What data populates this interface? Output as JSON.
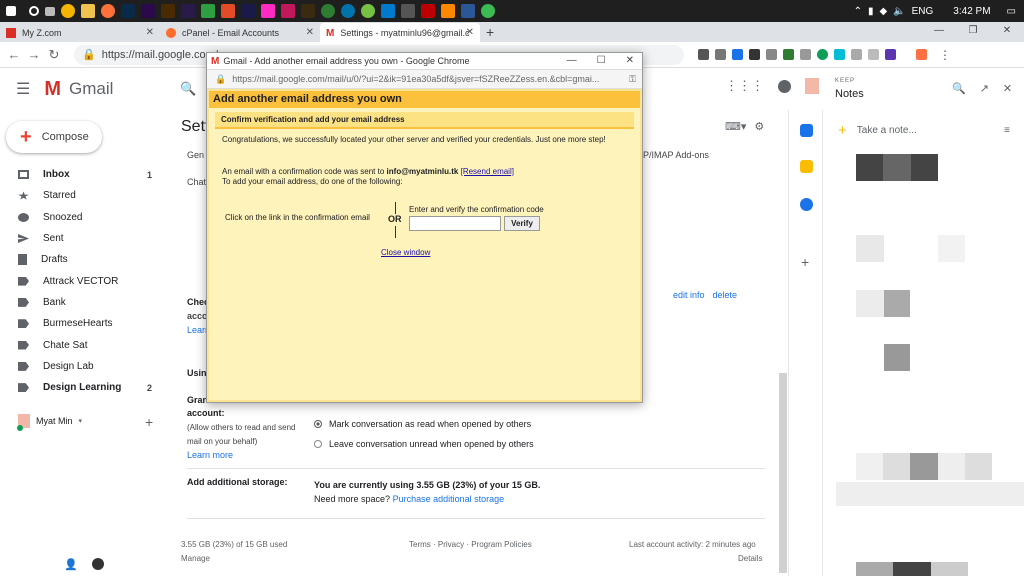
{
  "taskbar": {
    "time": "3:42 PM",
    "language": "ENG"
  },
  "tabs": [
    {
      "label": "My Z.com"
    },
    {
      "label": "cPanel - Email Accounts"
    },
    {
      "label": "Settings - myatminlu96@gmail.c"
    }
  ],
  "toolbar": {
    "url": "https://mail.google.com/m"
  },
  "gmail": {
    "brand": "Gmail",
    "compose": "Compose",
    "sidebar": [
      {
        "label": "Inbox",
        "count": "1",
        "bold": true
      },
      {
        "label": "Starred",
        "count": ""
      },
      {
        "label": "Snoozed",
        "count": ""
      },
      {
        "label": "Sent",
        "count": ""
      },
      {
        "label": "Drafts",
        "count": ""
      },
      {
        "label": "Attrack VECTOR",
        "count": ""
      },
      {
        "label": "Bank",
        "count": ""
      },
      {
        "label": "BurmeseHearts",
        "count": ""
      },
      {
        "label": "Chate Sat",
        "count": ""
      },
      {
        "label": "Design Lab",
        "count": ""
      },
      {
        "label": "Design Learning",
        "count": "2",
        "bold": true
      }
    ],
    "hangout_user": "Myat Min"
  },
  "settings": {
    "title": "Sett",
    "tab_gen": "Gen",
    "tabs_right": "OP/IMAP   Add-ons",
    "chat": "Chat",
    "check_label": "Chec",
    "check_sub": "accou",
    "learn_short": "Learn",
    "edit_info": "edit info",
    "delete": "delete",
    "using": "Usin",
    "grant_label": "Gran",
    "grant_label2": "account:",
    "grant_sub": "(Allow others to read and send mail on your behalf)",
    "learn_more": "Learn more",
    "radio1": "Mark conversation as read when opened by others",
    "radio2": "Leave conversation unread when opened by others",
    "storage_label": "Add additional storage:",
    "storage_text": "You are currently using 3.55 GB (23%) of your 15 GB.",
    "storage_need": "Need more space?",
    "storage_link": "Purchase additional storage",
    "footer_usage": "3.55 GB (23%) of 15 GB used",
    "footer_manage": "Manage",
    "footer_links": "Terms · Privacy · Program Policies",
    "footer_activity": "Last account activity: 2 minutes ago",
    "footer_details": "Details"
  },
  "keep": {
    "title": "KEEP",
    "name": "Notes",
    "take_note": "Take a note..."
  },
  "popup": {
    "window_title": "Gmail - Add another email address you own - Google Chrome",
    "url": "https://mail.google.com/mail/u/0/?ui=2&ik=91ea30a5df&jsver=fSZReeZZess.en.&cbl=gmai...",
    "heading": "Add another email address you own",
    "subheading": "Confirm verification and add your email address",
    "congrats": "Congratulations, we successfully located your other server and verified your credentials. Just one more step!",
    "sent_prefix": "An email with a confirmation code was sent to",
    "sent_email": "info@myatminlu.tk",
    "resend": "[Resend email]",
    "add_instr": "To add your email address, do one of the following:",
    "click_link": "Click on the link in the confirmation email",
    "or": "OR",
    "enter_code": "Enter and verify the confirmation code",
    "verify": "Verify",
    "close": "Close window"
  },
  "colors": {
    "gmail_red": "#d93025",
    "popup_bg": "#fff3bc",
    "popup_header": "#fbc13c",
    "link_blue": "#1a0dab"
  }
}
